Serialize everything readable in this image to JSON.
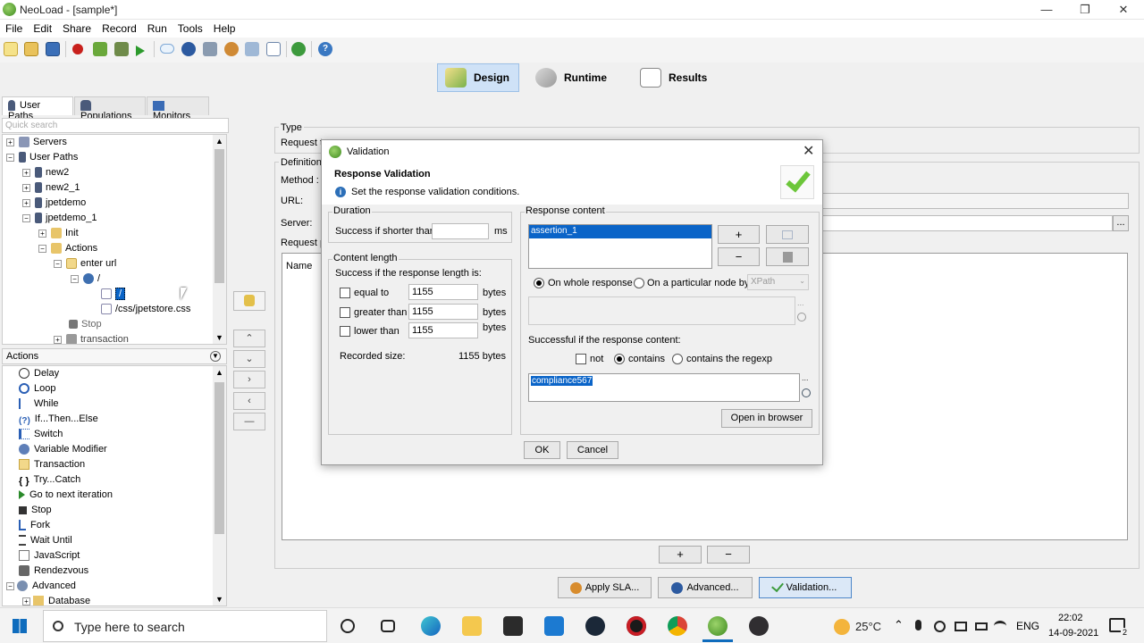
{
  "window": {
    "title": "NeoLoad - [sample*]"
  },
  "menu": [
    "File",
    "Edit",
    "Share",
    "Record",
    "Run",
    "Tools",
    "Help"
  ],
  "perspectives": {
    "design": "Design",
    "runtime": "Runtime",
    "results": "Results"
  },
  "left_tabs": {
    "user_paths": "User Paths",
    "populations": "Populations",
    "monitors": "Monitors"
  },
  "quick_search_placeholder": "Quick search",
  "tree": {
    "servers": "Servers",
    "user_paths": "User Paths",
    "new2": "new2",
    "new2_1": "new2_1",
    "jpetdemo": "jpetdemo",
    "jpetdemo_1": "jpetdemo_1",
    "init": "Init",
    "actions": "Actions",
    "enter_url": "enter url",
    "root_page": "/",
    "root_request": "/",
    "css_request": "/css/jpetstore.css",
    "stop": "Stop",
    "transaction": "transaction"
  },
  "actions_panel": {
    "header": "Actions",
    "items": [
      "Delay",
      "Loop",
      "While",
      "If...Then...Else",
      "Switch",
      "Variable Modifier",
      "Transaction",
      "Try...Catch",
      "Go to next iteration",
      "Stop",
      "Fork",
      "Wait Until",
      "JavaScript",
      "Rendezvous",
      "Advanced",
      "Database"
    ]
  },
  "request_panel": {
    "type_label": "Type",
    "request_label": "Request t",
    "definition_label": "Definition",
    "method_label": "Method :",
    "url_label": "URL:",
    "server_label": "Server:",
    "request_params_label": "Request p",
    "name_col": "Name",
    "add_label": "+",
    "remove_label": "−",
    "ellipsis": "...",
    "apply_sla": "Apply SLA...",
    "advanced": "Advanced...",
    "validation": "Validation..."
  },
  "dialog": {
    "title": "Validation",
    "heading": "Response Validation",
    "subtitle": "Set the response validation conditions.",
    "duration": {
      "label": "Duration",
      "success_if_shorter": "Success if shorter than",
      "value": "",
      "unit": "ms"
    },
    "content_length": {
      "label": "Content length",
      "intro": "Success if the response length is:",
      "equal_to": {
        "label": "equal to",
        "value": "1155",
        "unit": "bytes",
        "checked": false
      },
      "greater_than": {
        "label": "greater than",
        "value": "1155",
        "unit": "bytes",
        "checked": false
      },
      "lower_than": {
        "label": "lower than",
        "value": "1155",
        "unit": "bytes",
        "checked": false
      },
      "recorded_label": "Recorded size:",
      "recorded_value": "1155 bytes"
    },
    "response_content": {
      "label": "Response content",
      "assertions": [
        "assertion_1"
      ],
      "add": "+",
      "remove": "−",
      "on_whole": "On whole response",
      "on_node": "On a particular node by",
      "node_type": "XPath",
      "successful_if": "Successful if the response content:",
      "not": "not",
      "contains": "contains",
      "contains_regexp": "contains the regexp",
      "pattern": "compliance567",
      "open_in_browser": "Open in browser"
    },
    "ok": "OK",
    "cancel": "Cancel"
  },
  "taskbar": {
    "search_placeholder": "Type here to search",
    "temperature": "25°C",
    "language": "ENG",
    "time": "22:02",
    "date": "14-09-2021",
    "notification_count": "2"
  }
}
